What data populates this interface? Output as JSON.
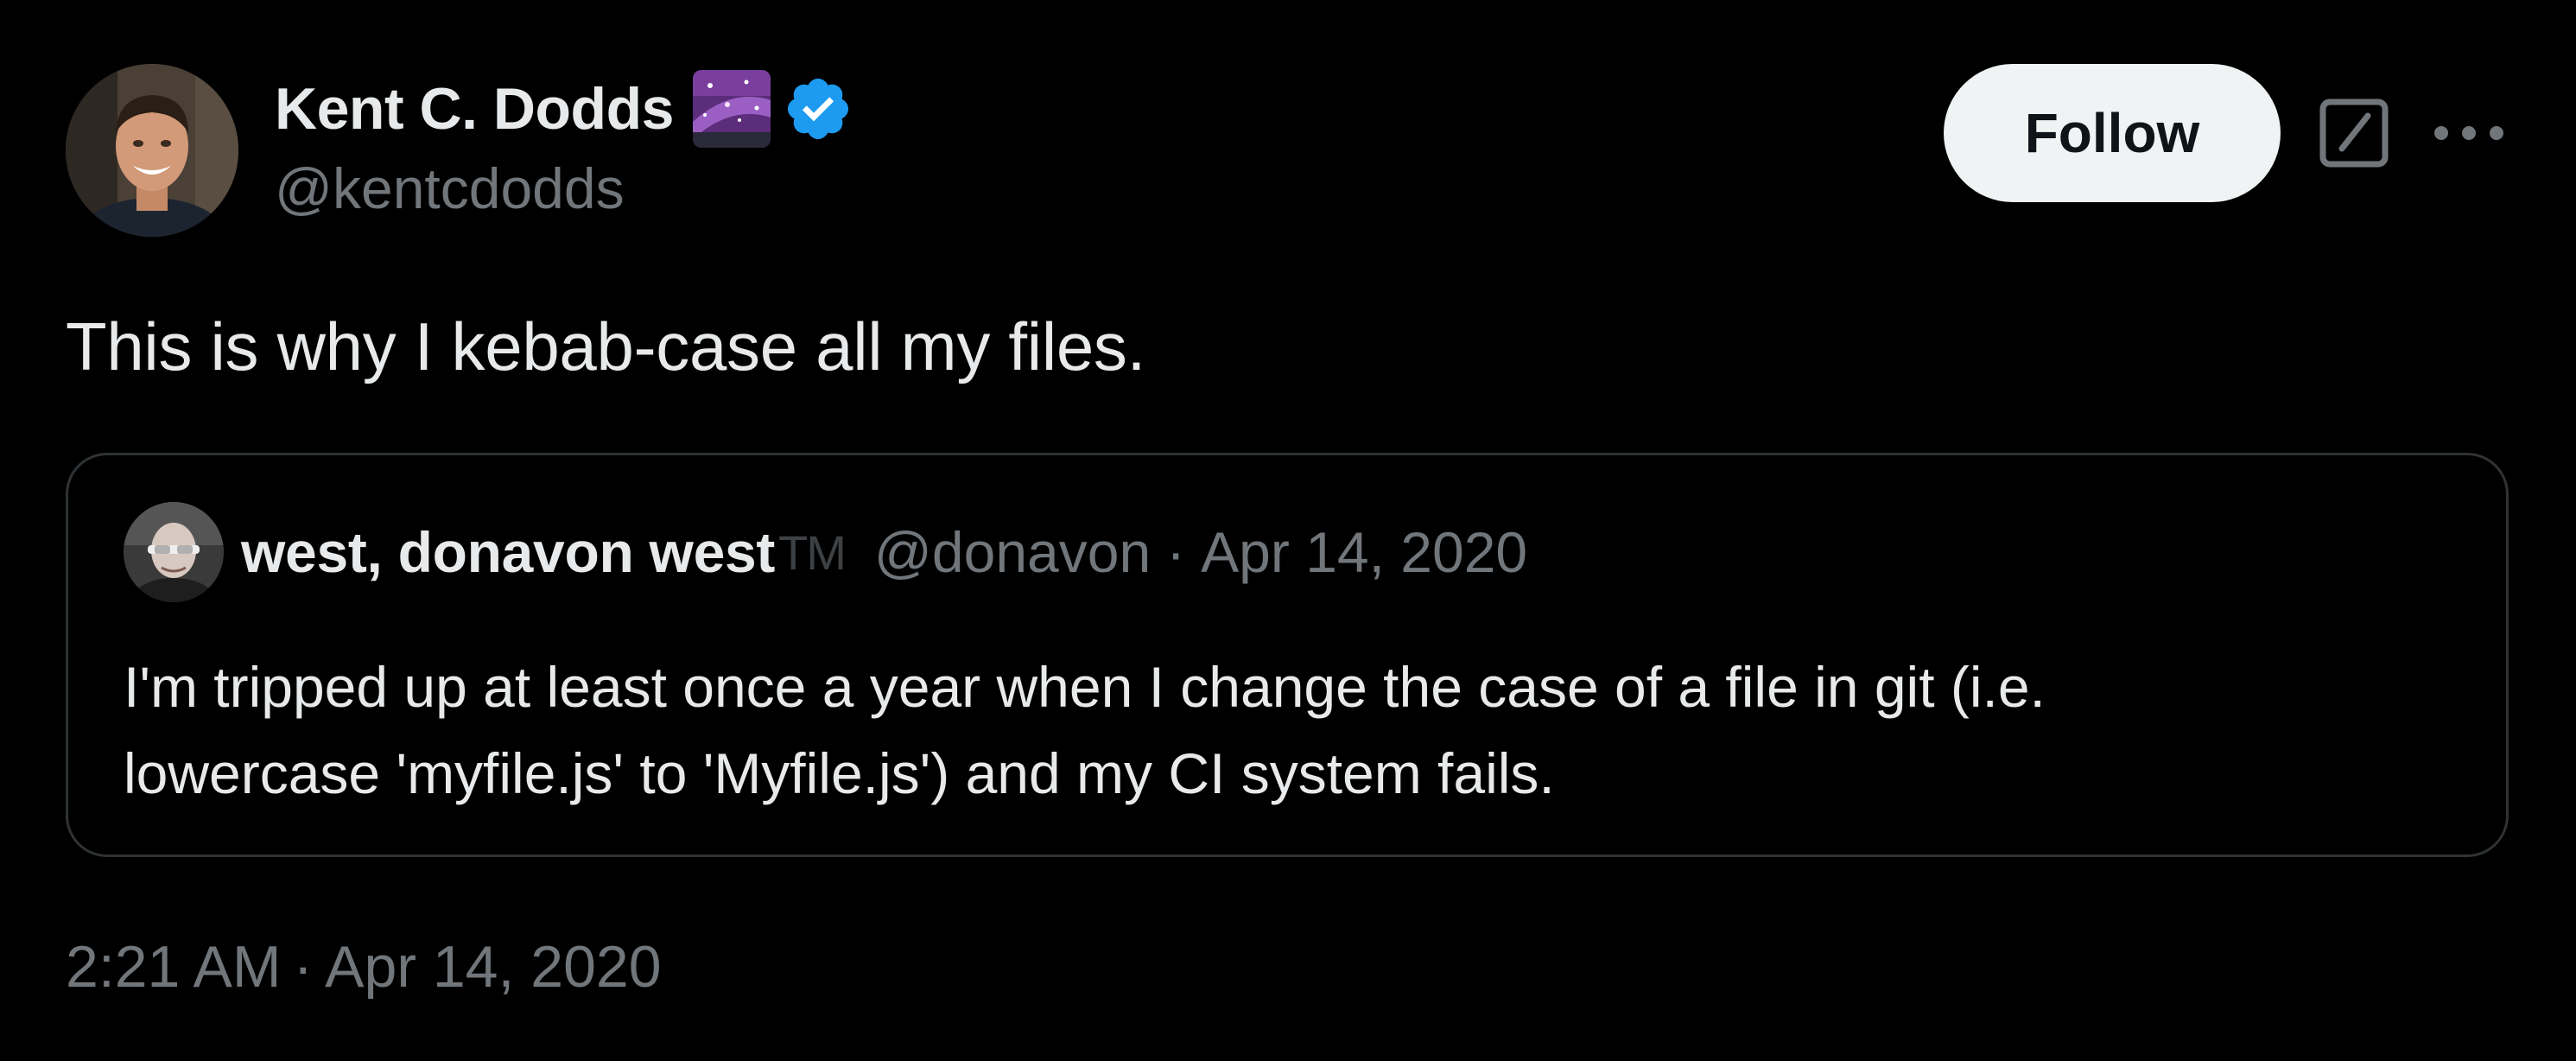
{
  "author": {
    "display_name": "Kent C. Dodds",
    "handle": "@kentcdodds",
    "avatar_icon": "profile-photo",
    "emoji_badge_icon": "milky-way-emoji",
    "verified_icon": "verified-badge-icon",
    "verified_color": "#1d9bf0"
  },
  "actions": {
    "follow_label": "Follow",
    "grok_icon": "grok-icon",
    "more_icon": "more-icon"
  },
  "tweet": {
    "text": "This is why I kebab-case all my files."
  },
  "quoted_tweet": {
    "display_name": "west, donavon west",
    "tm": "TM",
    "handle": "@donavon",
    "separator": "·",
    "date": "Apr 14, 2020",
    "text_lines": [
      "I'm tripped up at least once a year when I change the case of a file in git (i.e.",
      "lowercase 'myfile.js' to 'Myfile.js') and my CI system fails."
    ]
  },
  "timestamp": {
    "time": "2:21 AM",
    "separator": "·",
    "date": "Apr 14, 2020"
  },
  "colors": {
    "background": "#000000",
    "primary_text": "#e7e9ea",
    "secondary_text": "#71767b",
    "border": "#2f3336",
    "follow_bg": "#eff3f4",
    "follow_text": "#0f1419"
  }
}
